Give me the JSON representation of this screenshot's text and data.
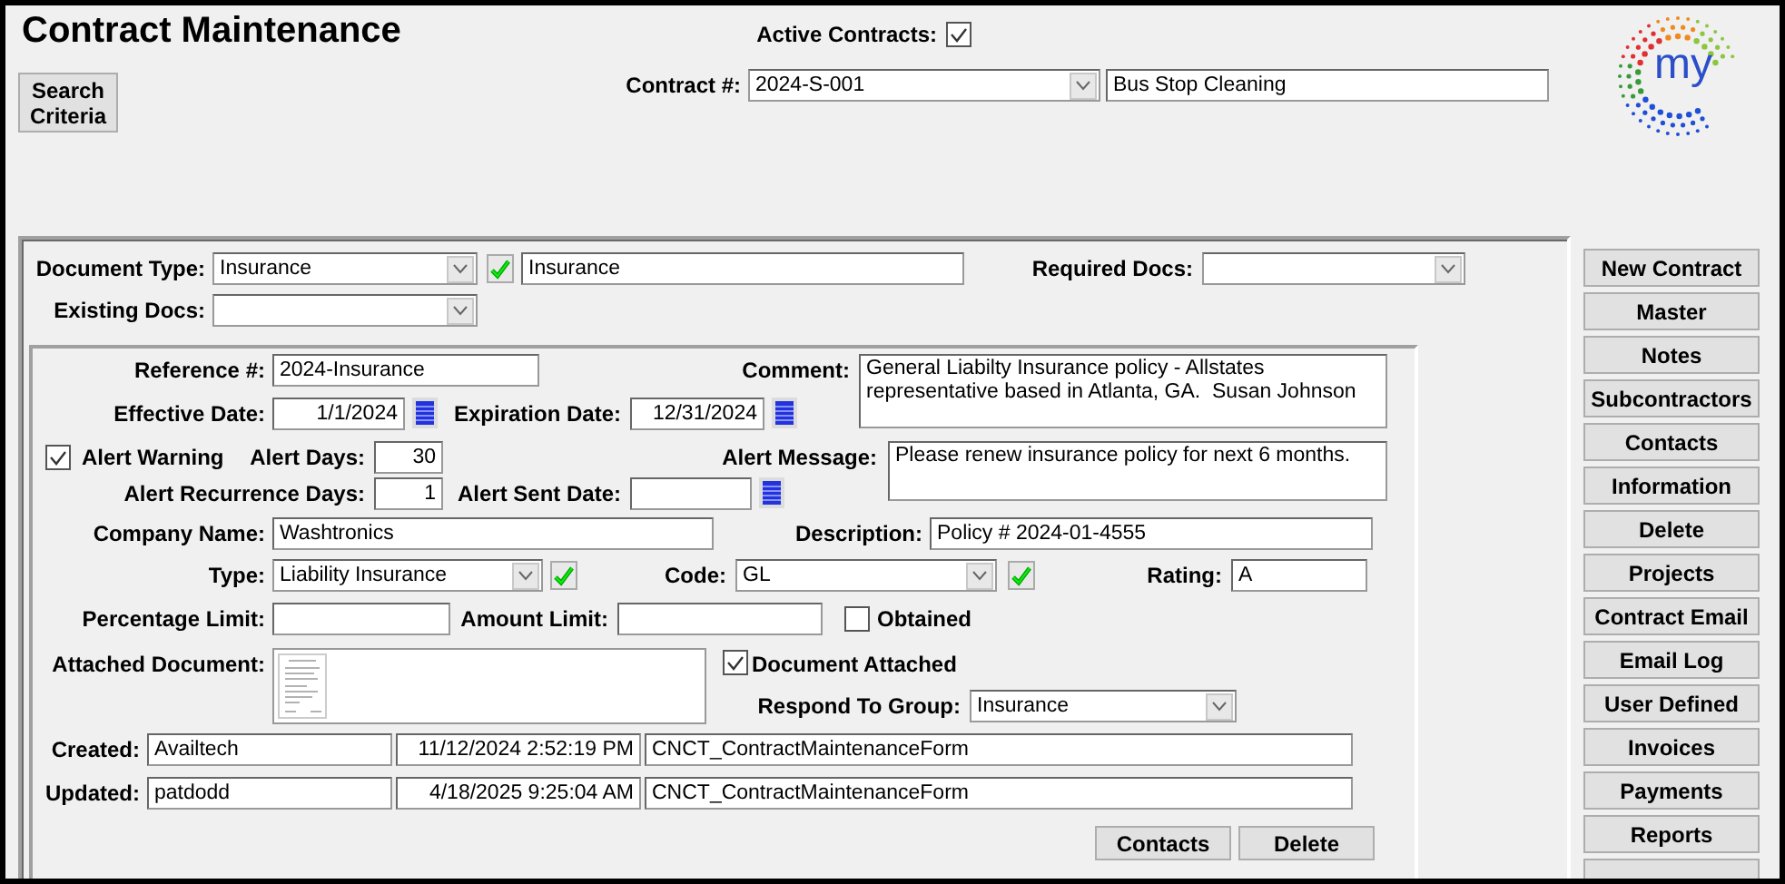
{
  "window": {
    "title": "Contract Maintenance",
    "logo_text": "my"
  },
  "search_button": "Search Criteria",
  "active_contracts": {
    "label": "Active Contracts:",
    "checked": true
  },
  "contract": {
    "label": "Contract #:",
    "number": "2024-S-001",
    "name": "Bus Stop Cleaning"
  },
  "document": {
    "type_label": "Document Type:",
    "type": "Insurance",
    "type_name": "Insurance",
    "required_docs_label": "Required Docs:",
    "existing_docs_label": "Existing Docs:"
  },
  "details": {
    "reference": {
      "label": "Reference #:",
      "value": "2024-Insurance"
    },
    "comment": {
      "label": "Comment:",
      "value": "General Liabilty Insurance policy - Allstates representative based in Atlanta, GA.  Susan Johnson"
    },
    "effective_date": {
      "label": "Effective Date:",
      "value": "1/1/2024"
    },
    "expiration_date": {
      "label": "Expiration Date:",
      "value": "12/31/2024"
    },
    "alert_warning": {
      "label": "Alert Warning",
      "checked": true
    },
    "alert_days": {
      "label": "Alert Days:",
      "value": "30"
    },
    "alert_message": {
      "label": "Alert Message:",
      "value": "Please renew insurance policy for next 6 months."
    },
    "alert_recurrence_days": {
      "label": "Alert Recurrence Days:",
      "value": "1"
    },
    "alert_sent_date": {
      "label": "Alert Sent Date:"
    },
    "company_name": {
      "label": "Company Name:",
      "value": "Washtronics"
    },
    "description": {
      "label": "Description:",
      "value": "Policy # 2024-01-4555"
    },
    "type": {
      "label": "Type:",
      "value": "Liability Insurance"
    },
    "code": {
      "label": "Code:",
      "value": "GL"
    },
    "rating": {
      "label": "Rating:",
      "value": "A"
    },
    "percentage_limit": {
      "label": "Percentage Limit:"
    },
    "amount_limit": {
      "label": "Amount Limit:"
    },
    "obtained": {
      "label": "Obtained",
      "checked": false
    },
    "attached_document": {
      "label": "Attached Document:"
    },
    "document_attached": {
      "label": "Document Attached",
      "checked": true
    },
    "respond_to_group": {
      "label": "Respond To Group:",
      "value": "Insurance"
    }
  },
  "audit": [
    {
      "label": "Created:",
      "user": "Availtech",
      "time": "11/12/2024 2:52:19 PM",
      "form": "CNCT_ContractMaintenanceForm"
    },
    {
      "label": "Updated:",
      "user": "patdodd",
      "time": "4/18/2025 9:25:04 AM",
      "form": "CNCT_ContractMaintenanceForm"
    }
  ],
  "form_buttons": [
    "Contacts",
    "Delete"
  ],
  "side_buttons": [
    "New Contract",
    "Master",
    "Notes",
    "Subcontractors",
    "Contacts",
    "Information",
    "Delete",
    "Projects",
    "Contract Email",
    "Email Log",
    "User Defined",
    "Invoices",
    "Payments",
    "Reports"
  ]
}
